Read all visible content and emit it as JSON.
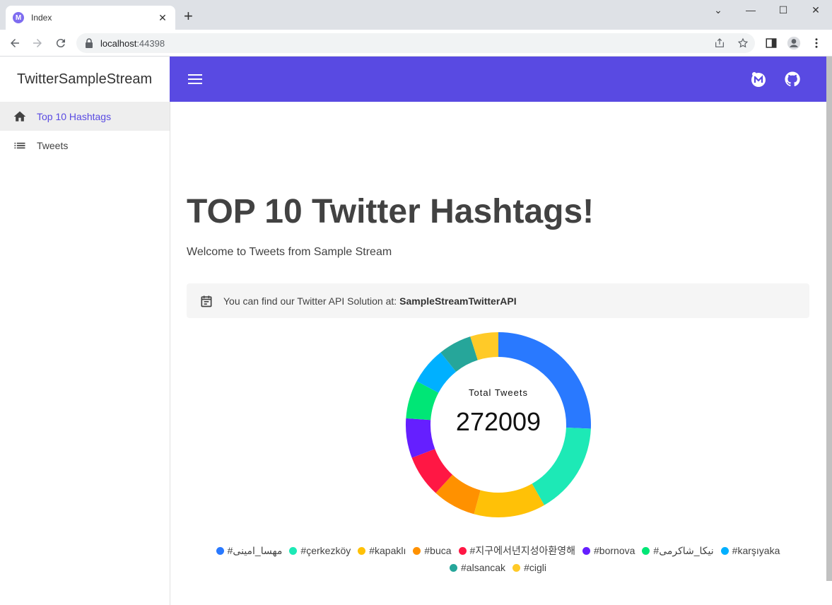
{
  "browser": {
    "tab_title": "Index",
    "tab_close": "✕",
    "new_tab": "+",
    "url_host": "localhost",
    "url_port": ":44398",
    "window_controls": [
      "⌄",
      "—",
      "☐",
      "✕"
    ]
  },
  "sidebar": {
    "brand": "TwitterSampleStream",
    "items": [
      {
        "label": "Top 10 Hashtags",
        "icon": "home-icon",
        "active": true
      },
      {
        "label": "Tweets",
        "icon": "list-icon",
        "active": false
      }
    ]
  },
  "appbar": {
    "color": "#594ae2",
    "icons": [
      "mudblazor-icon",
      "github-icon"
    ]
  },
  "main": {
    "heading": "TOP 10 Twitter Hashtags!",
    "subheading": "Welcome to Tweets from Sample Stream",
    "alert_text": "You can find our Twitter API Solution at:",
    "alert_link": "SampleStreamTwitterAPI"
  },
  "chart_data": {
    "type": "pie",
    "donut": true,
    "caption": "Total Tweets",
    "total": "272009",
    "legend_placement": "bottom",
    "categories": [
      "#مهسا_امینی",
      "#çerkezköy",
      "#kapaklı",
      "#buca",
      "#지구에서년지성아환영해",
      "#bornova",
      "#نیکا_شاکرمی",
      "#karşıyaka",
      "#alsancak",
      "#cigli"
    ],
    "values": [
      57500,
      36000,
      28000,
      17000,
      16500,
      15500,
      15000,
      14500,
      13000,
      11000
    ],
    "colors": [
      "#2979ff",
      "#1de9b6",
      "#ffc107",
      "#ff9100",
      "#ff1744",
      "#651fff",
      "#00e676",
      "#00b0ff",
      "#26a69a",
      "#ffca28"
    ]
  }
}
